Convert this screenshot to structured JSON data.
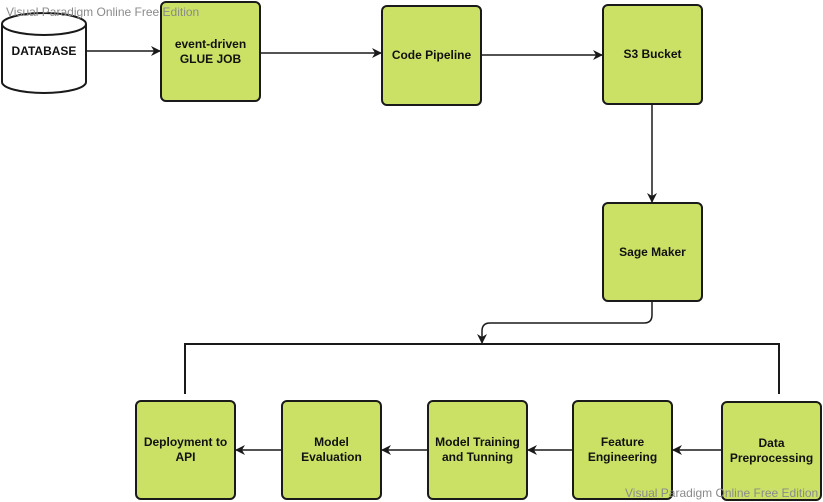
{
  "diagram": {
    "colors": {
      "node_fill": "#cbe165",
      "stroke": "#1a1a1a",
      "watermark": "#8a8a8a"
    },
    "nodes": [
      {
        "id": "database",
        "shape": "cylinder",
        "label": "DATABASE"
      },
      {
        "id": "glue",
        "shape": "rounded-rect",
        "label": "event-driven\nGLUE JOB"
      },
      {
        "id": "pipeline",
        "shape": "rounded-rect",
        "label": "Code Pipeline"
      },
      {
        "id": "s3",
        "shape": "rounded-rect",
        "label": "S3 Bucket"
      },
      {
        "id": "sagemaker",
        "shape": "rounded-rect",
        "label": "Sage Maker"
      },
      {
        "id": "deploy",
        "shape": "rounded-rect",
        "label": "Deployment to\nAPI"
      },
      {
        "id": "evaluation",
        "shape": "rounded-rect",
        "label": "Model\nEvaluation"
      },
      {
        "id": "training",
        "shape": "rounded-rect",
        "label": "Model Training\nand Tunning"
      },
      {
        "id": "feature",
        "shape": "rounded-rect",
        "label": "Feature\nEngineering"
      },
      {
        "id": "preprocess",
        "shape": "rounded-rect",
        "label": "Data\nPreprocessing"
      }
    ],
    "edges": [
      {
        "from": "database",
        "to": "glue"
      },
      {
        "from": "glue",
        "to": "pipeline"
      },
      {
        "from": "pipeline",
        "to": "s3"
      },
      {
        "from": "s3",
        "to": "sagemaker"
      },
      {
        "from": "sagemaker",
        "to": "ml-group"
      },
      {
        "from": "preprocess",
        "to": "feature"
      },
      {
        "from": "feature",
        "to": "training"
      },
      {
        "from": "training",
        "to": "evaluation"
      },
      {
        "from": "evaluation",
        "to": "deploy"
      }
    ],
    "groups": [
      {
        "id": "ml-group",
        "members": [
          "deploy",
          "evaluation",
          "training",
          "feature",
          "preprocess"
        ]
      }
    ]
  },
  "watermarks": {
    "top": "Visual Paradigm Online Free Edition",
    "bottom": "Visual Paradigm Online Free Edition"
  }
}
